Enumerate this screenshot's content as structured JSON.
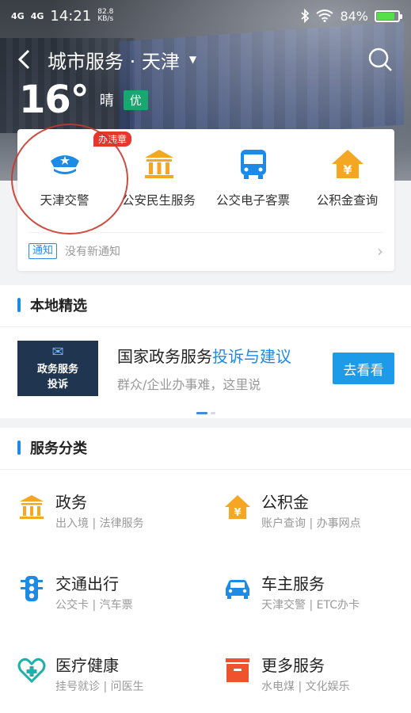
{
  "status": {
    "signal1": "4G",
    "signal2": "4G",
    "time": "14:21",
    "speed_value": "82.8",
    "speed_unit": "KB/s",
    "battery": "84%",
    "battery_level": 0.84
  },
  "nav": {
    "title": "城市服务 · 天津"
  },
  "weather": {
    "temp": "16°",
    "condition": "晴",
    "aqi": "优"
  },
  "quick": {
    "badge": "办违章",
    "items": [
      {
        "label": "天津交警",
        "icon": "police-cap-icon"
      },
      {
        "label": "公安民生服务",
        "icon": "bank-icon"
      },
      {
        "label": "公交电子客票",
        "icon": "bus-icon"
      },
      {
        "label": "公积金查询",
        "icon": "yuan-house-icon"
      }
    ],
    "notice_tag": "通知",
    "notice_text": "没有新通知"
  },
  "local": {
    "title": "本地精选",
    "image_line1": "政务服务",
    "image_line2": "投诉",
    "headline_prefix": "国家政务服务",
    "headline_highlight": "投诉与建议",
    "subline": "群众/企业办事难，这里说",
    "button": "去看看"
  },
  "services": {
    "title": "服务分类",
    "items": [
      {
        "name": "政务",
        "desc": "出入境 | 法律服务",
        "icon": "bank-icon"
      },
      {
        "name": "公积金",
        "desc": "账户查询 | 办事网点",
        "icon": "yuan-house-icon"
      },
      {
        "name": "交通出行",
        "desc": "公交卡 | 汽车票",
        "icon": "traffic-light-icon"
      },
      {
        "name": "车主服务",
        "desc": "天津交警 | ETC办卡",
        "icon": "car-icon"
      },
      {
        "name": "医疗健康",
        "desc": "挂号就诊 | 问医生",
        "icon": "medical-heart-icon"
      },
      {
        "name": "更多服务",
        "desc": "水电煤 | 文化娱乐",
        "icon": "box-icon"
      }
    ]
  },
  "colors": {
    "accent": "#1d8ae5",
    "orange": "#f5a623",
    "badge_red": "#e8352d",
    "aqi_green": "#1aa66f"
  }
}
